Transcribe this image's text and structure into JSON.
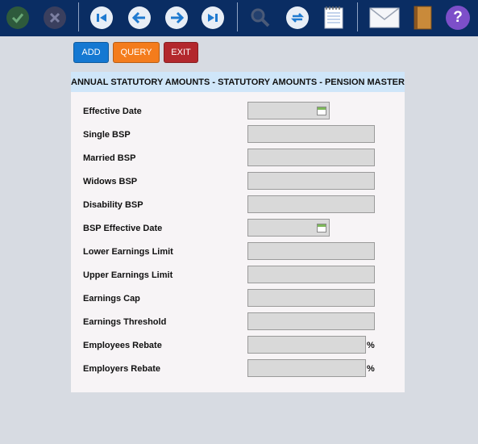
{
  "toolbar": {
    "icons": [
      "checkmark-icon",
      "cancel-icon",
      "first-record-icon",
      "previous-icon",
      "next-icon",
      "last-record-icon",
      "search-icon",
      "refresh-icon",
      "notepad-icon",
      "mail-icon",
      "notebook-icon",
      "help-icon"
    ],
    "help_glyph": "?"
  },
  "actions": {
    "add_label": "ADD",
    "query_label": "QUERY",
    "exit_label": "EXIT"
  },
  "colors": {
    "toolbar_bg": "#0a2d63",
    "add": "#1478d2",
    "query": "#f47c1c",
    "exit": "#b3282d",
    "panel_title_bg": "#cfe6f9"
  },
  "panel": {
    "title": "ANNUAL STATUTORY AMOUNTS - STATUTORY AMOUNTS - PENSION MASTER"
  },
  "form": {
    "fields": [
      {
        "label": "Effective Date",
        "value": ""
      },
      {
        "label": "Single BSP",
        "value": ""
      },
      {
        "label": "Married BSP",
        "value": ""
      },
      {
        "label": "Widows BSP",
        "value": ""
      },
      {
        "label": "Disability BSP",
        "value": ""
      },
      {
        "label": "BSP Effective Date",
        "value": ""
      },
      {
        "label": "Lower Earnings Limit",
        "value": ""
      },
      {
        "label": "Upper Earnings Limit",
        "value": ""
      },
      {
        "label": "Earnings Cap",
        "value": ""
      },
      {
        "label": "Earnings Threshold",
        "value": ""
      },
      {
        "label": "Employees Rebate",
        "value": ""
      },
      {
        "label": "Employers Rebate",
        "value": ""
      }
    ],
    "percent_symbol": "%"
  }
}
